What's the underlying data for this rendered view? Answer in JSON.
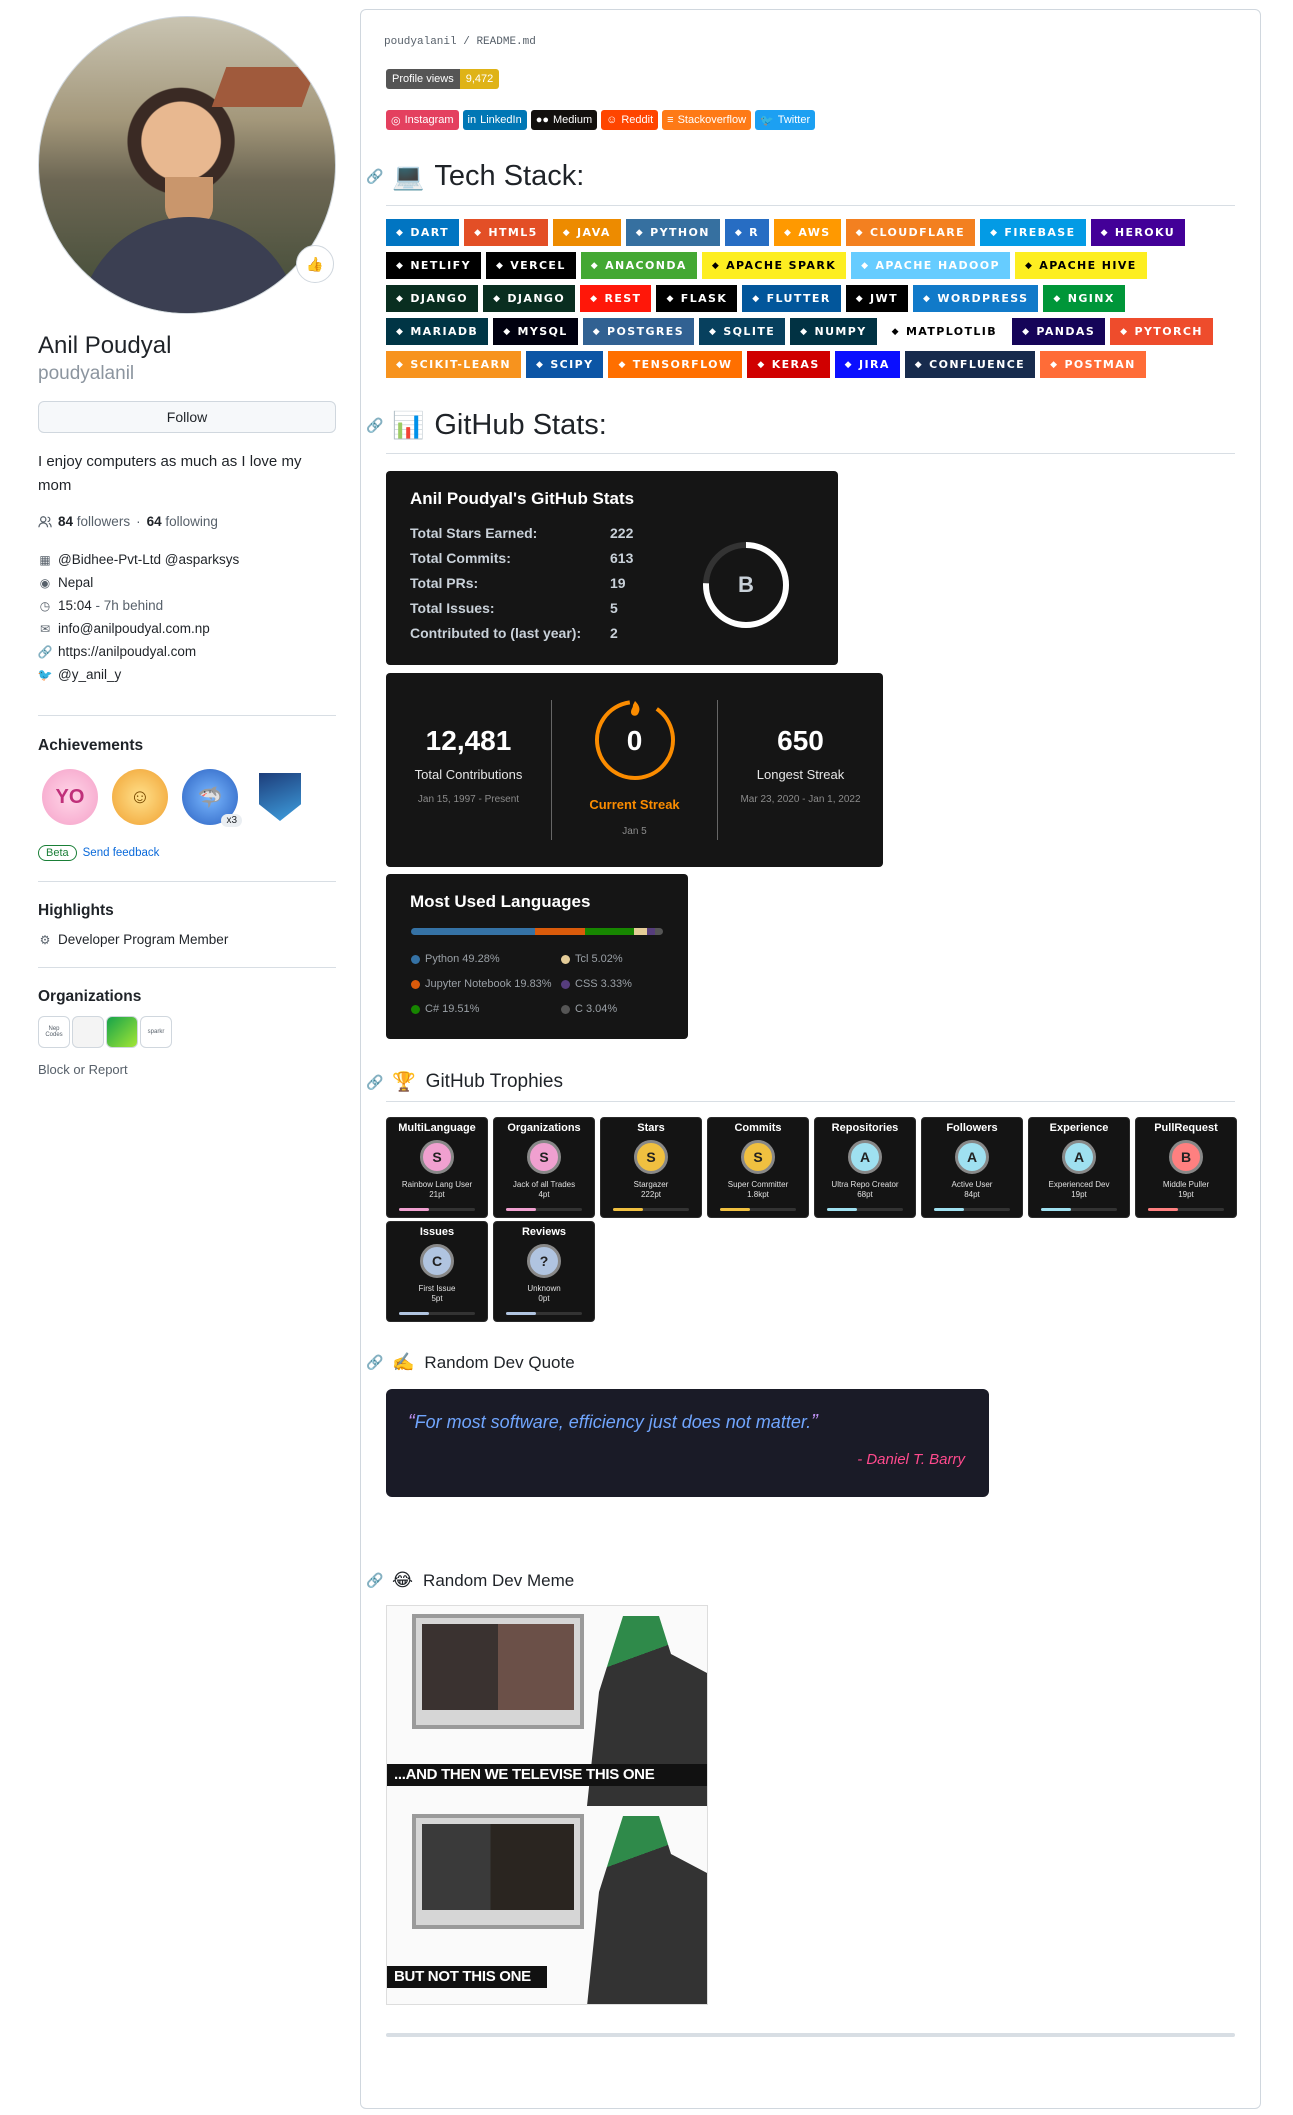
{
  "profile": {
    "name": "Anil Poudyal",
    "login": "poudyalanil",
    "follow_label": "Follow",
    "bio": "I enjoy computers as much as I love my mom",
    "status_emoji": "👍",
    "followers_count": "84",
    "followers_label": "followers",
    "sep": " · ",
    "following_count": "64",
    "following_label": "following",
    "company": "@Bidhee-Pvt-Ltd @asparksys",
    "location": "Nepal",
    "time": "15:04",
    "time_behind": " - 7h behind",
    "email": "info@anilpoudyal.com.np",
    "website": "https://anilpoudyal.com",
    "twitter": "@y_anil_y"
  },
  "achievements": {
    "title": "Achievements",
    "badge_count": "x3",
    "beta": "Beta",
    "feedback": "Send feedback"
  },
  "highlights": {
    "title": "Highlights",
    "item": "Developer Program Member"
  },
  "organizations": {
    "title": "Organizations",
    "orgs": [
      "Nep Codes",
      "",
      "",
      "sparkr"
    ]
  },
  "block_report": "Block or Report",
  "readme": {
    "path_user": "poudyalanil",
    "path_sep": " / ",
    "path_file": "README.md",
    "views_label": "Profile views",
    "views_count": "9,472",
    "socials": [
      {
        "label": "Instagram",
        "color": "#e4405f"
      },
      {
        "label": "LinkedIn",
        "color": "#0077b5"
      },
      {
        "label": "Medium",
        "color": "#12100e"
      },
      {
        "label": "Reddit",
        "color": "#ff4500"
      },
      {
        "label": "Stackoverflow",
        "color": "#fe7a16"
      },
      {
        "label": "Twitter",
        "color": "#1ca0f2"
      }
    ],
    "tech_title": "Tech Stack:",
    "tech_emoji": "💻",
    "tech_rows": [
      [
        {
          "l": "DART",
          "c": "#0175c2"
        },
        {
          "l": "HTML5",
          "c": "#e34f26"
        },
        {
          "l": "JAVA",
          "c": "#ed8b00"
        },
        {
          "l": "PYTHON",
          "c": "#3670a0"
        },
        {
          "l": "R",
          "c": "#276dc3"
        },
        {
          "l": "AWS",
          "c": "#ff9900"
        },
        {
          "l": "CLOUDFLARE",
          "c": "#f38020"
        },
        {
          "l": "FIREBASE",
          "c": "#039be5"
        },
        {
          "l": "HEROKU",
          "c": "#430098"
        }
      ],
      [
        {
          "l": "NETLIFY",
          "c": "#000000"
        },
        {
          "l": "VERCEL",
          "c": "#000000"
        },
        {
          "l": "ANACONDA",
          "c": "#44a833"
        },
        {
          "l": "APACHE SPARK",
          "c": "#fdee21",
          "t": "#000"
        },
        {
          "l": "APACHE HADOOP",
          "c": "#66ccff"
        },
        {
          "l": "APACHE HIVE",
          "c": "#fdee21",
          "t": "#000"
        }
      ],
      [
        {
          "l": "DJANGO",
          "c": "#092e20"
        },
        {
          "l": "DJANGO",
          "c": "#092e20"
        },
        {
          "l": "REST",
          "c": "#ff1709"
        },
        {
          "l": "FLASK",
          "c": "#000000"
        },
        {
          "l": "FLUTTER",
          "c": "#02569b"
        },
        {
          "l": "JWT",
          "c": "#000000"
        },
        {
          "l": "WORDPRESS",
          "c": "#117ac9"
        },
        {
          "l": "NGINX",
          "c": "#009639"
        }
      ],
      [
        {
          "l": "MARIADB",
          "c": "#003545"
        },
        {
          "l": "MYSQL",
          "c": "#00000f"
        },
        {
          "l": "POSTGRES",
          "c": "#316192"
        },
        {
          "l": "SQLITE",
          "c": "#07405e"
        },
        {
          "l": "NUMPY",
          "c": "#013243"
        },
        {
          "l": "MATPLOTLIB",
          "c": "#ffffff",
          "t": "#000"
        },
        {
          "l": "PANDAS",
          "c": "#150458"
        },
        {
          "l": "PYTORCH",
          "c": "#ee4c2c"
        }
      ],
      [
        {
          "l": "SCIKIT-LEARN",
          "c": "#f7931e"
        },
        {
          "l": "SCIPY",
          "c": "#0c55a5"
        },
        {
          "l": "TENSORFLOW",
          "c": "#ff6f00"
        },
        {
          "l": "KERAS",
          "c": "#d00000"
        },
        {
          "l": "JIRA",
          "c": "#0a0fff"
        },
        {
          "l": "CONFLUENCE",
          "c": "#172b4d"
        },
        {
          "l": "POSTMAN",
          "c": "#ff6c37"
        }
      ]
    ],
    "stats_title": "GitHub Stats:",
    "stats_emoji": "📊",
    "stats_card": {
      "title": "Anil Poudyal's GitHub Stats",
      "rank": "B",
      "rows": [
        {
          "k": "Total Stars Earned:",
          "v": "222"
        },
        {
          "k": "Total Commits:",
          "v": "613"
        },
        {
          "k": "Total PRs:",
          "v": "19"
        },
        {
          "k": "Total Issues:",
          "v": "5"
        },
        {
          "k": "Contributed to (last year):",
          "v": "2"
        }
      ]
    },
    "streak": {
      "total": "12,481",
      "total_label": "Total Contributions",
      "total_range": "Jan 15, 1997 - Present",
      "current": "0",
      "current_label": "Current Streak",
      "current_range": "Jan 5",
      "longest": "650",
      "longest_label": "Longest Streak",
      "longest_range": "Mar 23, 2020 - Jan 1, 2022"
    },
    "langs": {
      "title": "Most Used Languages",
      "items": [
        {
          "name": "Python 49.28%",
          "pct": 49.28,
          "color": "#3572a5"
        },
        {
          "name": "Tcl 5.02%",
          "pct": 5.02,
          "color": "#e4cc98"
        },
        {
          "name": "Jupyter Notebook 19.83%",
          "pct": 19.83,
          "color": "#da5b0b"
        },
        {
          "name": "CSS 3.33%",
          "pct": 3.33,
          "color": "#563d7c"
        },
        {
          "name": "C# 19.51%",
          "pct": 19.51,
          "color": "#178600"
        },
        {
          "name": "C 3.04%",
          "pct": 3.04,
          "color": "#555555"
        }
      ]
    },
    "trophies_title": "GitHub Trophies",
    "trophies_emoji": "🏆",
    "trophies": [
      {
        "t": "MultiLanguage",
        "r": "S",
        "s": "Rainbow Lang User",
        "p": "21pt",
        "c": "#f0a0d0"
      },
      {
        "t": "Organizations",
        "r": "S",
        "s": "Jack of all Trades",
        "p": "4pt",
        "c": "#f0a0d0"
      },
      {
        "t": "Stars",
        "r": "S",
        "s": "Stargazer",
        "p": "222pt",
        "c": "#f0c040"
      },
      {
        "t": "Commits",
        "r": "S",
        "s": "Super Committer",
        "p": "1.8kpt",
        "c": "#f0c040"
      },
      {
        "t": "Repositories",
        "r": "A",
        "s": "Ultra Repo Creator",
        "p": "68pt",
        "c": "#9fe0f0"
      },
      {
        "t": "Followers",
        "r": "A",
        "s": "Active User",
        "p": "84pt",
        "c": "#9fe0f0"
      },
      {
        "t": "Experience",
        "r": "A",
        "s": "Experienced Dev",
        "p": "19pt",
        "c": "#9fe0f0"
      },
      {
        "t": "PullRequest",
        "r": "B",
        "s": "Middle Puller",
        "p": "19pt",
        "c": "#ff8080"
      },
      {
        "t": "Issues",
        "r": "C",
        "s": "First Issue",
        "p": "5pt",
        "c": "#b0c4e0"
      },
      {
        "t": "Reviews",
        "r": "?",
        "s": "Unknown",
        "p": "0pt",
        "c": "#b0c4e0"
      }
    ],
    "quote_title": "Random Dev Quote",
    "quote_emoji": "✍️",
    "quote": {
      "open": "“",
      "text": "For most software, efficiency just does not matter.",
      "close": "”",
      "author": "- Daniel T. Barry"
    },
    "meme_title": "Random Dev Meme",
    "meme_emoji": "😂",
    "meme": {
      "top": "...AND THEN WE TELEVISE THIS ONE",
      "bottom": "BUT NOT THIS ONE"
    }
  }
}
